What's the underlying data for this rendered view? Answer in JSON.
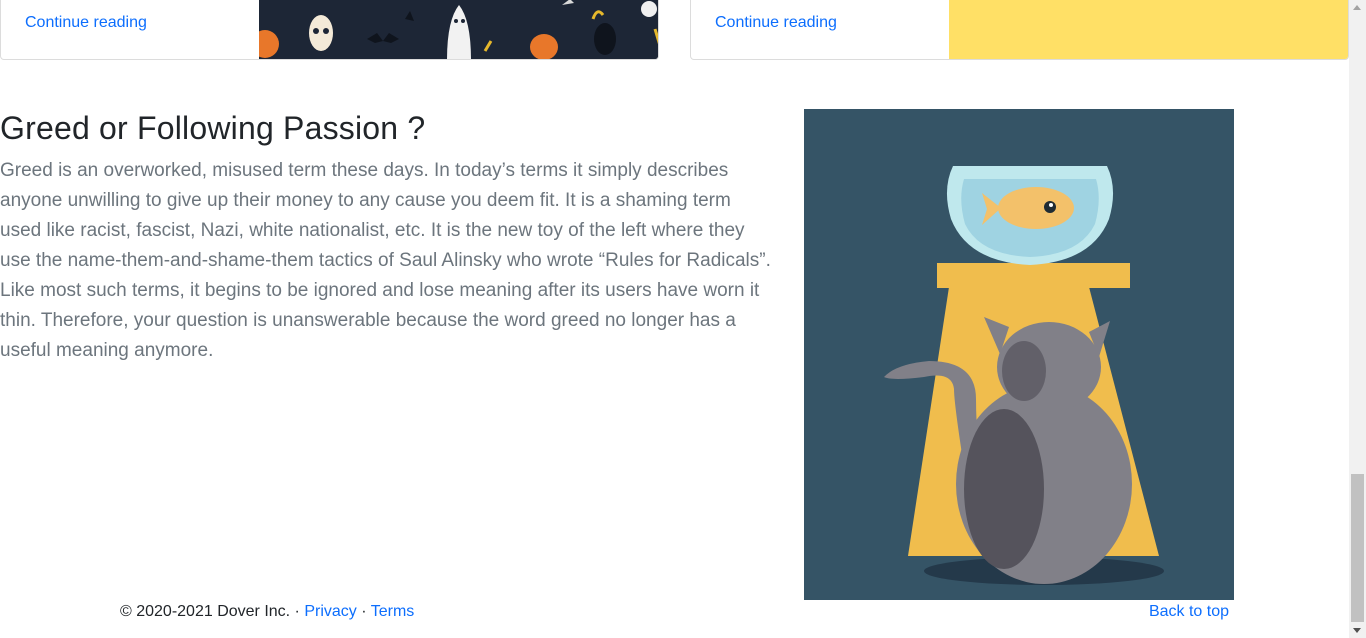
{
  "cards": [
    {
      "link_label": "Continue reading",
      "thumb": "halloween-illustration"
    },
    {
      "link_label": "Continue reading",
      "thumb": "yellow-placeholder"
    }
  ],
  "article": {
    "title": "Greed or Following Passion ?",
    "body": "Greed is an overworked, misused term these days. In today’s terms it simply describes anyone unwilling to give up their money to any cause you deem fit. It is a shaming term used like racist, fascist, Nazi, white nationalist, etc. It is the new toy of the left where they use the name-them-and-shame-them tactics of Saul Alinsky who wrote “Rules for Radicals”. Like most such terms, it begins to be ignored and lose meaning after its users have worn it thin. Therefore, your question is unanswerable because the word greed no longer has a useful meaning anymore.",
    "image": "cat-watching-goldfish-illustration"
  },
  "footer": {
    "copyright": "© 2020-2021 Dover Inc. · ",
    "privacy": "Privacy",
    "separator": " · ",
    "terms": "Terms",
    "back_to_top": "Back to top"
  },
  "colors": {
    "link": "#0d6efd",
    "illustration_bg": "#355466",
    "pedestal": "#f0bd4d",
    "cat": "#818088",
    "bowl": "#bfe8ed",
    "fish": "#f3c16a",
    "card_yellow": "#ffe066"
  }
}
